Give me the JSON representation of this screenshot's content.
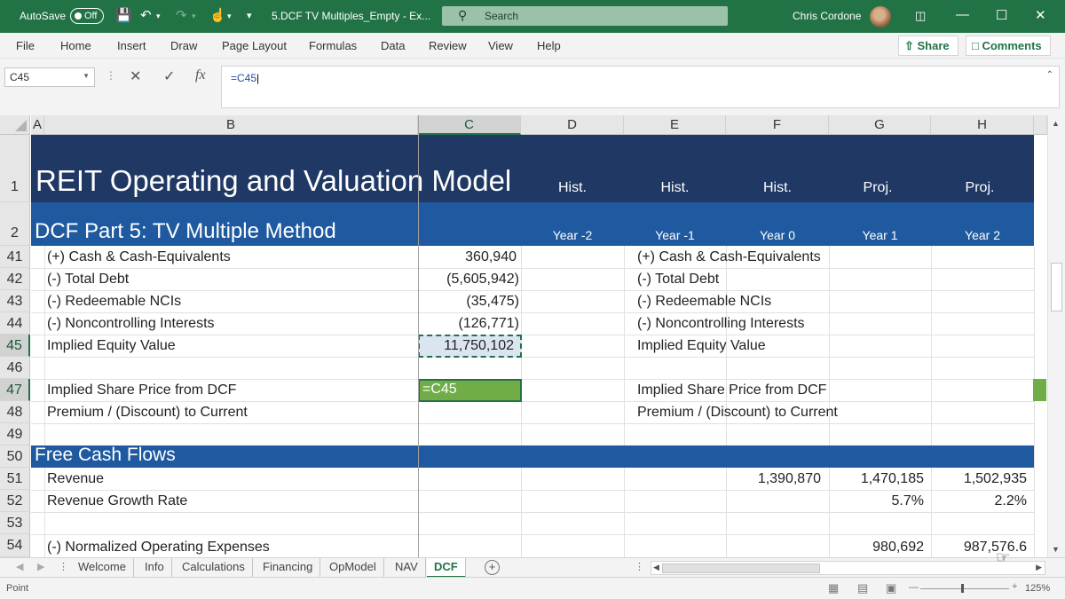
{
  "titlebar": {
    "autosave_label": "AutoSave",
    "autosave_state": "Off",
    "document_title": "5.DCF TV Multiples_Empty  -  Ex...",
    "search_placeholder": "Search",
    "user_name": "Chris Cordone"
  },
  "ribbon": {
    "tabs": [
      "File",
      "Home",
      "Insert",
      "Draw",
      "Page Layout",
      "Formulas",
      "Data",
      "Review",
      "View",
      "Help"
    ],
    "share_label": "Share",
    "comments_label": "Comments"
  },
  "formula_bar": {
    "name_box": "C45",
    "formula": "=C45",
    "fx_label": "fx"
  },
  "columns": [
    "A",
    "B",
    "C",
    "D",
    "E",
    "F",
    "G",
    "H"
  ],
  "header_rows": {
    "r1": {
      "row": "1",
      "title": "REIT Operating and Valuation Model",
      "labels": [
        "Hist.",
        "Hist.",
        "Hist.",
        "Proj.",
        "Proj."
      ]
    },
    "r2": {
      "row": "2",
      "title": "DCF Part 5: TV Multiple Method",
      "years": [
        "Year -2",
        "Year -1",
        "Year 0",
        "Year 1",
        "Year 2"
      ]
    }
  },
  "rows": [
    {
      "row": "41",
      "label": "(+) Cash & Cash-Equivalents",
      "c": "360,940",
      "e": "(+) Cash & Cash-Equivalents",
      "f": "",
      "g": "",
      "h": ""
    },
    {
      "row": "42",
      "label": "(-) Total Debt",
      "c": "(5,605,942)",
      "e": "(-) Total Debt",
      "f": "",
      "g": "",
      "h": ""
    },
    {
      "row": "43",
      "label": "(-) Redeemable NCIs",
      "c": "(35,475)",
      "e": "(-) Redeemable NCIs",
      "f": "",
      "g": "",
      "h": ""
    },
    {
      "row": "44",
      "label": "(-) Noncontrolling Interests",
      "c": "(126,771)",
      "e": "(-) Noncontrolling Interests",
      "f": "",
      "g": "",
      "h": ""
    },
    {
      "row": "45",
      "label": "Implied Equity Value",
      "c": "11,750,102",
      "e": "Implied Equity Value",
      "f": "",
      "g": "",
      "h": ""
    },
    {
      "row": "46",
      "label": "",
      "c": "",
      "e": "",
      "f": "",
      "g": "",
      "h": ""
    },
    {
      "row": "47",
      "label": "Implied Share Price from DCF",
      "c": "=C45",
      "e": "Implied Share Price from DCF",
      "f": "",
      "g": "",
      "h": ""
    },
    {
      "row": "48",
      "label": "Premium / (Discount) to Current",
      "c": "",
      "e": "Premium / (Discount) to Current",
      "f": "",
      "g": "",
      "h": ""
    },
    {
      "row": "49",
      "label": "",
      "c": "",
      "e": "",
      "f": "",
      "g": "",
      "h": ""
    }
  ],
  "section_row": {
    "row": "50",
    "title": "Free Cash Flows"
  },
  "rows2": [
    {
      "row": "51",
      "label": "Revenue",
      "f": "1,390,870",
      "g": "1,470,185",
      "h": "1,502,935"
    },
    {
      "row": "52",
      "label": "Revenue Growth Rate",
      "f": "",
      "g": "5.7%",
      "h": "2.2%"
    },
    {
      "row": "53",
      "label": "",
      "f": "",
      "g": "",
      "h": ""
    },
    {
      "row": "54",
      "label": "(-) Normalized Operating Expenses",
      "f": "",
      "g": "980,692",
      "h": "987,576.6"
    }
  ],
  "sheets": [
    "Welcome",
    "Info",
    "Calculations",
    "Financing",
    "OpModel",
    "NAV",
    "DCF"
  ],
  "active_sheet": "DCF",
  "status": {
    "mode": "Point",
    "zoom": "125%"
  },
  "colors": {
    "excel_green": "#217346",
    "header_navy": "#1f3864",
    "header_blue": "#1f5aa0",
    "edit_green": "#70ad47"
  }
}
